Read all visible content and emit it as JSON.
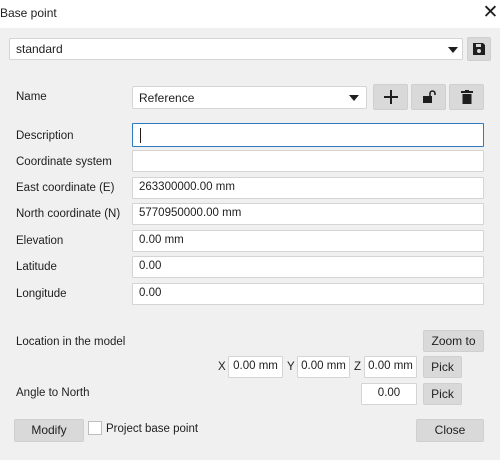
{
  "window": {
    "title": "Base point",
    "close_glyph": "✕"
  },
  "preset": {
    "value": "standard",
    "save_icon": "floppy-disk-icon"
  },
  "name_row": {
    "label": "Name",
    "value": "Reference",
    "add_icon": "plus-icon",
    "lock_icon": "unlocked-padlock-icon",
    "delete_icon": "trash-icon"
  },
  "fields": {
    "description": {
      "label": "Description",
      "value": ""
    },
    "coordinate_system": {
      "label": "Coordinate system",
      "value": ""
    },
    "east": {
      "label": "East coordinate  (E)",
      "value": "263300000.00 mm"
    },
    "north": {
      "label": "North coordinate  (N)",
      "value": "5770950000.00 mm"
    },
    "elevation": {
      "label": "Elevation",
      "value": "0.00 mm"
    },
    "latitude": {
      "label": "Latitude",
      "value": "0.00"
    },
    "longitude": {
      "label": "Longitude",
      "value": "0.00"
    }
  },
  "location": {
    "label": "Location in the model",
    "zoom_to": "Zoom to",
    "x_label": "X",
    "x_value": "0.00 mm",
    "y_label": "Y",
    "y_value": "0.00 mm",
    "z_label": "Z",
    "z_value": "0.00 mm",
    "pick": "Pick"
  },
  "angle": {
    "label": "Angle to North",
    "value": "0.00",
    "pick": "Pick"
  },
  "footer": {
    "modify": "Modify",
    "project_base_point": "Project base point",
    "project_base_point_checked": false,
    "close": "Close"
  },
  "colors": {
    "background": "#f0f0f0",
    "focus_border": "#2d7ac0",
    "button_fill": "#d9d9d9"
  }
}
